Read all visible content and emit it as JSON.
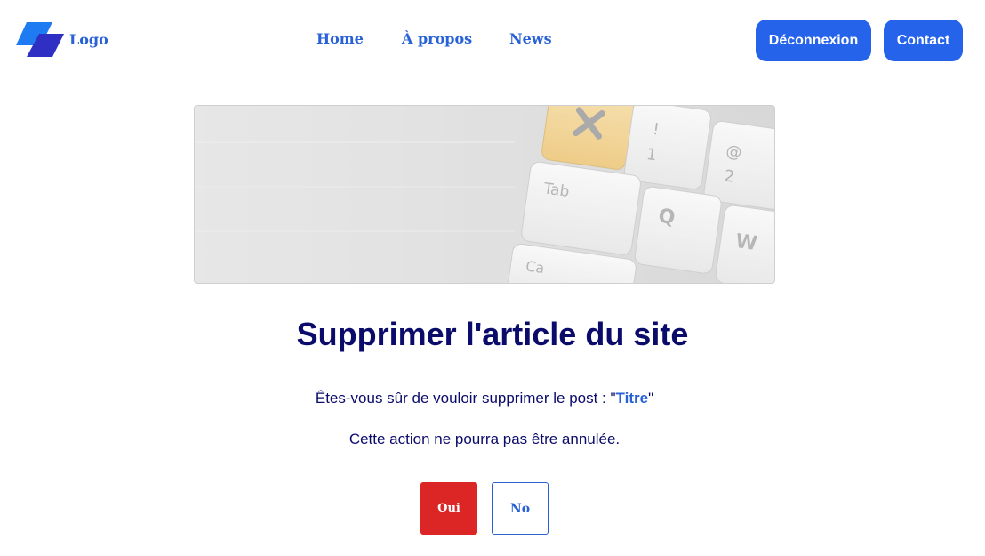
{
  "header": {
    "logo_text": "Logo",
    "nav": [
      {
        "label": "Home"
      },
      {
        "label": "À propos"
      },
      {
        "label": "News"
      }
    ],
    "logout_label": "Déconnexion",
    "contact_label": "Contact"
  },
  "hero": {
    "keys": [
      "!",
      "1",
      "@",
      "2",
      "Tab",
      "Q",
      "W",
      "Ca"
    ]
  },
  "main": {
    "title": "Supprimer l'article du site",
    "question_prefix": "Êtes-vous sûr de vouloir supprimer le post : \"",
    "post_title": "Titre",
    "question_suffix": "\"",
    "warning": "Cette action ne pourra pas être annulée.",
    "yes_label": "Oui",
    "no_label": "No"
  },
  "colors": {
    "accent": "#2563eb",
    "link": "#2962d6",
    "heading": "#0b0b6b",
    "danger": "#dc2626"
  }
}
